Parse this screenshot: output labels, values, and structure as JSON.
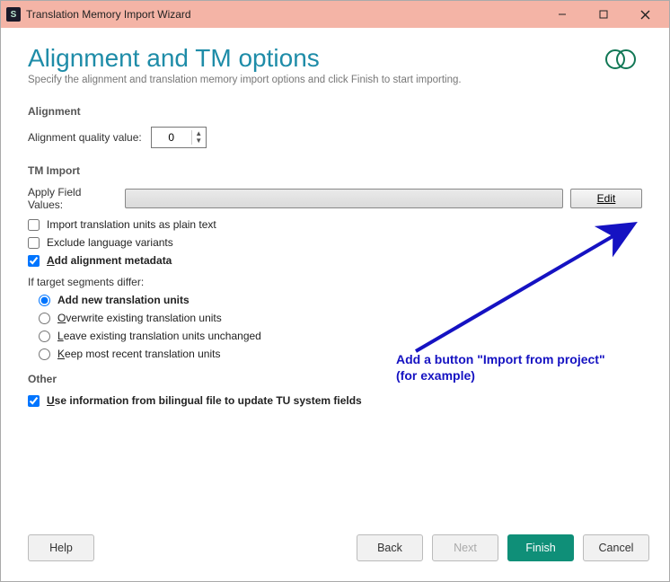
{
  "window": {
    "title": "Translation Memory Import Wizard"
  },
  "page": {
    "title": "Alignment and TM options",
    "subtitle": "Specify the alignment and translation memory import options and click Finish to start importing."
  },
  "alignment": {
    "heading": "Alignment",
    "quality_label": "Alignment quality value:",
    "quality_value": "0"
  },
  "tm_import": {
    "heading": "TM Import",
    "apply_label": "Apply Field Values:",
    "apply_value": "",
    "edit_btn": "Edit",
    "chk_plain": "Import translation units as plain text",
    "chk_exclude": "Exclude language variants",
    "chk_addmeta": "Add alignment metadata",
    "differ_label": "If target segments differ:",
    "rad_add": "Add new translation units",
    "rad_over": "Overwrite existing translation units",
    "rad_leave": "Leave existing translation units unchanged",
    "rad_keep": "Keep most recent translation units"
  },
  "other": {
    "heading": "Other",
    "chk_bilingual": "Use information from bilingual file to update TU system fields"
  },
  "annotation": {
    "line1": "Add a button \"Import from project\"",
    "line2": "(for example)"
  },
  "footer": {
    "help": "Help",
    "back": "Back",
    "next": "Next",
    "finish": "Finish",
    "cancel": "Cancel"
  }
}
